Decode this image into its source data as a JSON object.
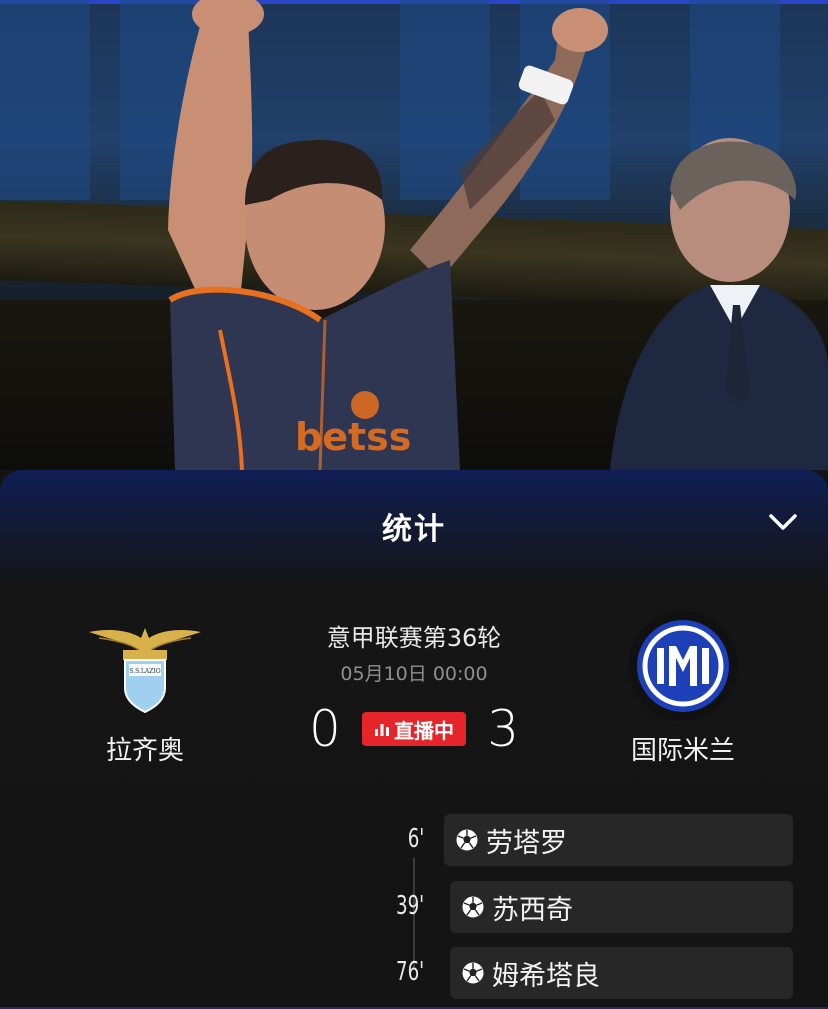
{
  "sheet": {
    "title": "统计",
    "collapse_icon": "chevron-down-icon"
  },
  "match": {
    "competition": "意甲联赛第36轮",
    "kickoff": "05月10日 00:00",
    "live_label": "直播中",
    "live_color": "#e6252a",
    "home": {
      "name": "拉齐奥",
      "score": "0",
      "logo": "lazio-crest-icon"
    },
    "away": {
      "name": "国际米兰",
      "score": "3",
      "logo": "inter-crest-icon"
    }
  },
  "goals": [
    {
      "minute": "6'",
      "scorer": "劳塔罗",
      "icon": "soccer-ball-icon"
    },
    {
      "minute": "39'",
      "scorer": "苏西奇",
      "icon": "soccer-ball-icon"
    },
    {
      "minute": "76'",
      "scorer": "姆希塔良",
      "icon": "soccer-ball-icon"
    }
  ],
  "colors": {
    "accent_blue": "#2a46c8",
    "background": "#141414",
    "card": "#272727"
  }
}
